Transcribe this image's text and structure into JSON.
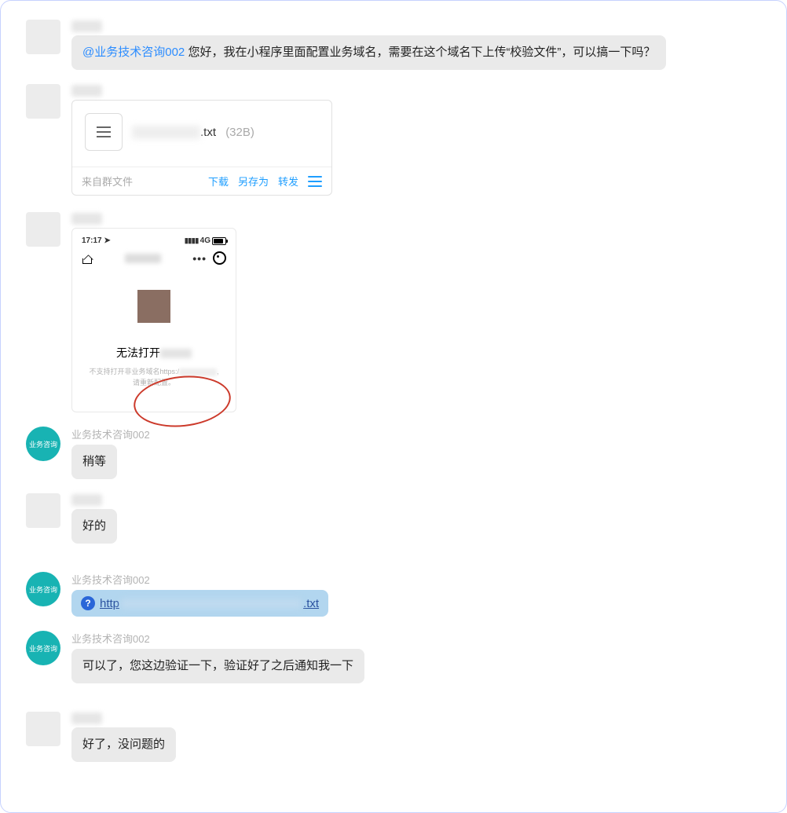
{
  "messages": {
    "m1": {
      "sender_display": "xxxxxx",
      "mention": "@业务技术咨询002",
      "text": "您好，我在小程序里面配置业务域名，需要在这个域名下上传“校验文件”，可以搞一下吗？"
    },
    "m2": {
      "sender_display": "xxxxxx",
      "file": {
        "name_hidden": "xxxxxxxxxx",
        "ext": ".txt",
        "size": "(32B)",
        "source_label": "来自群文件",
        "action_download": "下载",
        "action_saveas": "另存为",
        "action_forward": "转发"
      }
    },
    "m3": {
      "sender_display": "xxxxxx",
      "phone": {
        "time": "17:17",
        "signal_label": "4G",
        "error_heading": "无法打开",
        "error_sub_prefix": "不支持打开非业务域名https:/",
        "error_sub_suffix": "请重新配置。"
      }
    },
    "m4": {
      "sender_display": "业务技术咨询002",
      "avatar_label": "业务咨询",
      "text": "稍等"
    },
    "m5": {
      "sender_display": "xxxxxx",
      "text": "好的"
    },
    "m6": {
      "sender_display": "业务技术咨询002",
      "avatar_label": "业务咨询",
      "link_prefix": "http",
      "link_suffix": ".txt"
    },
    "m7": {
      "sender_display": "业务技术咨询002",
      "avatar_label": "业务咨询",
      "text": "可以了，您这边验证一下，验证好了之后通知我一下"
    },
    "m8": {
      "sender_display": "xxxxxx",
      "text": "好了，没问题的"
    }
  }
}
